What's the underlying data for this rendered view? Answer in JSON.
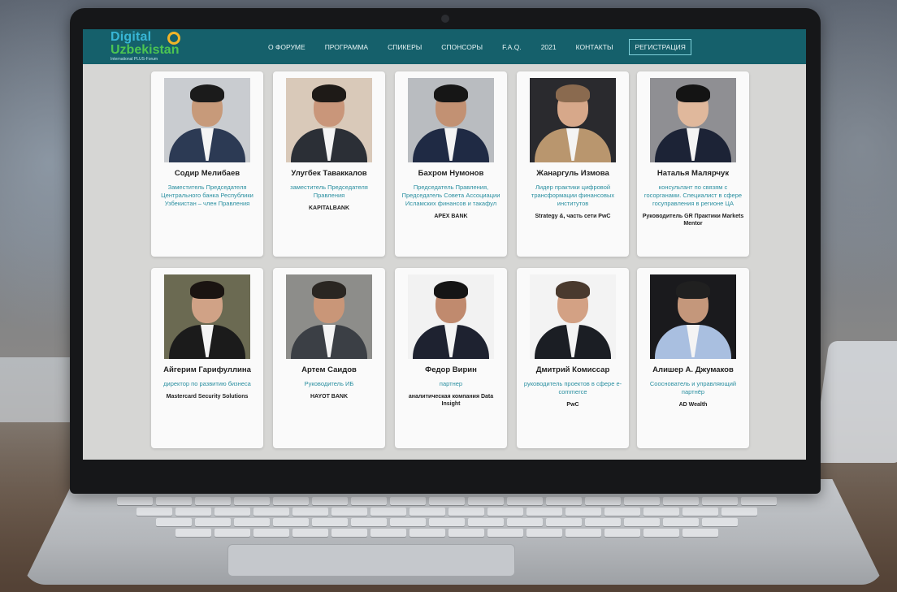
{
  "nav": {
    "logo_line1": "Digital",
    "logo_line2": "Uzbekistan",
    "logo_line3": "International PLUS-Forum",
    "items": [
      "О ФОРУМЕ",
      "ПРОГРАММА",
      "СПИКЕРЫ",
      "СПОНСОРЫ",
      "F.A.Q.",
      "2021",
      "КОНТАКТЫ"
    ],
    "register": "РЕГИСТРАЦИЯ"
  },
  "speakers": [
    {
      "name": "Содир Мелибаев",
      "role": "Заместитель Председателя Центрального банка Республики Узбекистан – член Правления",
      "org": "",
      "bg": "#c9ccd0",
      "skin": "#c79a7a",
      "hair": "#1b1b1b",
      "suit": "#2c3a54"
    },
    {
      "name": "Улугбек Таваккалов",
      "role": "заместитель Председателя Правления",
      "org": "KAPITALBANK",
      "bg": "#d9c9b9",
      "skin": "#c9967a",
      "hair": "#1e1a17",
      "suit": "#2b2f36"
    },
    {
      "name": "Бахром Нумонов",
      "role": "Председатель Правления, Председатель Совета Ассоциации Исламских финансов и такафул",
      "org": "APEX BANK",
      "bg": "#b9bcc0",
      "skin": "#c29173",
      "hair": "#161616",
      "suit": "#1f2a44"
    },
    {
      "name": "Жанаргуль Измова",
      "role": "Лидер практики цифровой трансформации финансовых институтов",
      "org": "Strategy &, часть сети PwC",
      "bg": "#2a2a2e",
      "skin": "#d7a88a",
      "hair": "#8a6a4f",
      "suit": "#b9966e"
    },
    {
      "name": "Наталья Малярчук",
      "role": "консультант по связям с госорганами. Специалист в сфере госуправления в регионе ЦА",
      "org": "Руководитель GR Практики Markets Mentor",
      "bg": "#8f8f93",
      "skin": "#e0b89c",
      "hair": "#141414",
      "suit": "#1c2336"
    },
    {
      "name": "Айгерим Гарифуллина",
      "role": "директор по развитию бизнеса",
      "org": "Mastercard Security Solutions",
      "bg": "#6b6a52",
      "skin": "#d0a286",
      "hair": "#1a1411",
      "suit": "#1b1b1b"
    },
    {
      "name": "Артем Саидов",
      "role": "Руководитель ИБ",
      "org": "HAYOT BANK",
      "bg": "#8d8d8a",
      "skin": "#c99678",
      "hair": "#2a2622",
      "suit": "#3b3f45"
    },
    {
      "name": "Федор Вирин",
      "role": "партнер",
      "org": "аналитическая компания Data Insight",
      "bg": "#f2f2f2",
      "skin": "#c08a6e",
      "hair": "#151515",
      "suit": "#1e2230"
    },
    {
      "name": "Дмитрий Комиссар",
      "role": "руководитель проектов в сфере e-commerce",
      "org": "PwC",
      "bg": "#f3f3f3",
      "skin": "#d3a184",
      "hair": "#4a3a2e",
      "suit": "#1b1e24"
    },
    {
      "name": "Алишер А. Джумаков",
      "role": "Сооснователь и управляющий партнёр",
      "org": "AD Wealth",
      "bg": "#1a1a1d",
      "skin": "#c4977b",
      "hair": "#202020",
      "suit": "#a9bfe0"
    }
  ]
}
